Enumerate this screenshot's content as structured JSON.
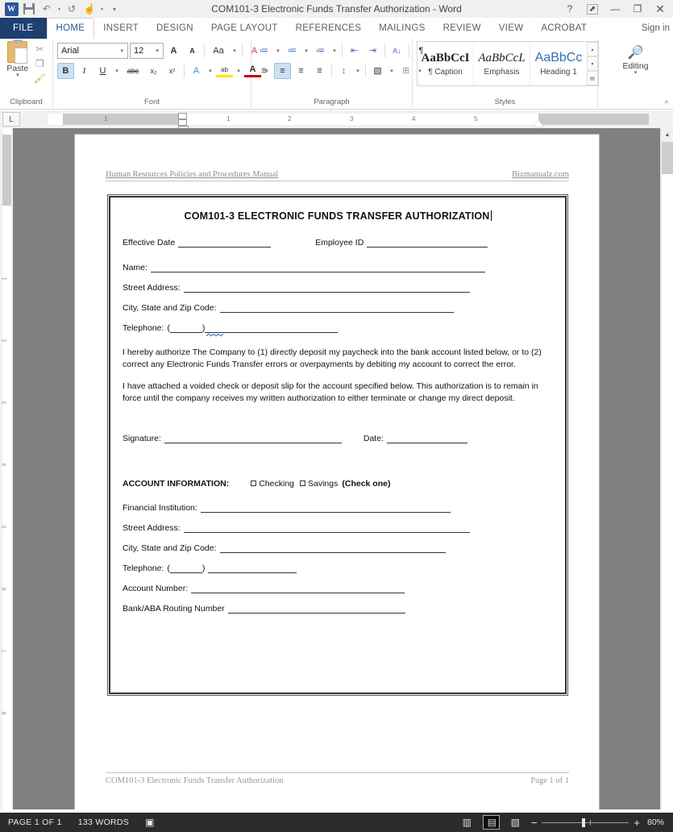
{
  "window": {
    "title": "COM101-3 Electronic Funds Transfer Authorization - Word",
    "app_logo": "word-logo",
    "quick_access": [
      {
        "name": "save-icon",
        "glyph": ""
      },
      {
        "name": "undo-icon",
        "glyph": "↶"
      },
      {
        "name": "redo-icon",
        "glyph": "↺"
      },
      {
        "name": "touch-mode-icon",
        "glyph": "☝"
      },
      {
        "name": "customize-qat-icon",
        "glyph": "⌄"
      }
    ],
    "controls": [
      {
        "name": "help-button",
        "glyph": "?"
      },
      {
        "name": "ribbon-display-options-button",
        "glyph": "⬈"
      },
      {
        "name": "minimize-button",
        "glyph": "—"
      },
      {
        "name": "restore-button",
        "glyph": "❐"
      },
      {
        "name": "close-button",
        "glyph": "✕"
      }
    ]
  },
  "tabs": {
    "file": "FILE",
    "items": [
      "HOME",
      "INSERT",
      "DESIGN",
      "PAGE LAYOUT",
      "REFERENCES",
      "MAILINGS",
      "REVIEW",
      "VIEW",
      "ACROBAT"
    ],
    "active": "HOME",
    "sign_in": "Sign in"
  },
  "ribbon": {
    "clipboard": {
      "label": "Clipboard",
      "paste_label": "Paste",
      "paste_caret": "▾",
      "cut_icon": "✂",
      "copy_icon": "❐",
      "format_painter_icon": "🖌",
      "dialog_launcher": "⬓"
    },
    "font": {
      "label": "Font",
      "font_family": "Arial",
      "font_size": "12",
      "grow_font": "A",
      "shrink_font": "A",
      "change_case": "Aa",
      "clear_formatting": "A",
      "bold": "B",
      "italic": "I",
      "underline": "U",
      "strikethrough": "abc",
      "subscript": "x₂",
      "superscript": "x²",
      "text_effects": "A",
      "highlight": "ab",
      "font_color": "A",
      "dialog_launcher": "⬓"
    },
    "paragraph": {
      "label": "Paragraph",
      "bullets": "≔",
      "numbering": "≔",
      "multilevel": "≔",
      "decrease_indent": "⇤",
      "increase_indent": "⇥",
      "sort": "A↓",
      "show_marks": "¶",
      "align_left": "≡",
      "align_center": "≡",
      "align_right": "≡",
      "justify": "≡",
      "line_spacing": "↕",
      "shading": "▧",
      "borders": "⊞",
      "dialog_launcher": "⬓"
    },
    "styles": {
      "label": "Styles",
      "items": [
        {
          "preview": "AaBbCcI",
          "name": "¶ Caption"
        },
        {
          "preview": "AaBbCcL",
          "name": "Emphasis"
        },
        {
          "preview": "AaBbCc",
          "name": "Heading 1"
        }
      ],
      "scroll_up": "▴",
      "scroll_down": "▾",
      "more": "▤",
      "dialog_launcher": "⬓"
    },
    "editing": {
      "label": "Editing",
      "icon": "🔎",
      "caret": "▾"
    },
    "collapse_ribbon": "^"
  },
  "ruler": {
    "tab_selector": "L",
    "h_ticks": [
      "1",
      "1",
      "2",
      "3",
      "4",
      "5"
    ],
    "v_ticks": [
      "1",
      "2",
      "3",
      "4",
      "5",
      "6",
      "7",
      "8"
    ]
  },
  "document": {
    "header": {
      "left": "Human Resources Policies and Procedures Manual",
      "right": "Bizmanualz.com"
    },
    "title": "COM101-3 ELECTRONIC FUNDS TRANSFER AUTHORIZATION",
    "top_fields": [
      {
        "label": "Effective Date",
        "line_width": 115
      },
      {
        "label": "Employee ID",
        "line_width": 150
      }
    ],
    "person_fields": [
      {
        "label": "Name:",
        "line_width": 415
      },
      {
        "label": "Street Address:",
        "line_width": 355
      },
      {
        "label": "City, State and Zip Code:",
        "line_width": 290
      },
      {
        "label": "Telephone:",
        "prefix": "(",
        "paren_width": 40,
        "suffix": ")",
        "line_width": 165
      }
    ],
    "paragraphs": [
      "I hereby authorize The Company to (1) directly deposit my paycheck into the bank account listed below, or to (2) correct any Electronic Funds Transfer errors or overpayments by debiting my account to correct the error.",
      "I have attached a voided check or deposit slip for the account specified below.  This authorization is to remain in force until the company receives my written authorization to either terminate or change my direct deposit."
    ],
    "signature_row": [
      {
        "label": "Signature:",
        "line_width": 220
      },
      {
        "label": "Date:",
        "line_width": 100
      }
    ],
    "account_section": {
      "heading": "ACCOUNT INFORMATION:",
      "checkbox_1": "Checking",
      "checkbox_2": "Savings",
      "note": "(Check one)"
    },
    "account_fields": [
      {
        "label": "Financial Institution:",
        "line_width": 310
      },
      {
        "label": "Street Address:",
        "line_width": 355
      },
      {
        "label": "City, State and Zip Code:",
        "line_width": 280
      },
      {
        "label": "Telephone:",
        "prefix": "(",
        "paren_width": 40,
        "suffix": ")",
        "line_width": 110
      },
      {
        "label": "Account Number:",
        "line_width": 265
      },
      {
        "label": "Bank/ABA Routing Number",
        "line_width": 220
      }
    ],
    "footer": {
      "left": "COM101-3 Electronic Funds Transfer Authorization",
      "right": "Page 1 of 1"
    }
  },
  "status_bar": {
    "page": "PAGE 1 OF 1",
    "words": "133 WORDS",
    "proofing_icon": "spell-check-icon",
    "views": [
      {
        "name": "read-mode-view-button",
        "glyph": "▥",
        "selected": false
      },
      {
        "name": "print-layout-view-button",
        "glyph": "▤",
        "selected": true
      },
      {
        "name": "web-layout-view-button",
        "glyph": "▧",
        "selected": false
      }
    ],
    "zoom_out": "−",
    "zoom_in": "+",
    "zoom_level": "80%"
  },
  "colors": {
    "accent": "#2b579a",
    "titlebar_bg": "#f0f0f0",
    "file_tab_bg": "#1e3f6f",
    "status_bg": "#2b2b2b",
    "doc_bg": "#808080",
    "squiggle": "#4472c4"
  }
}
